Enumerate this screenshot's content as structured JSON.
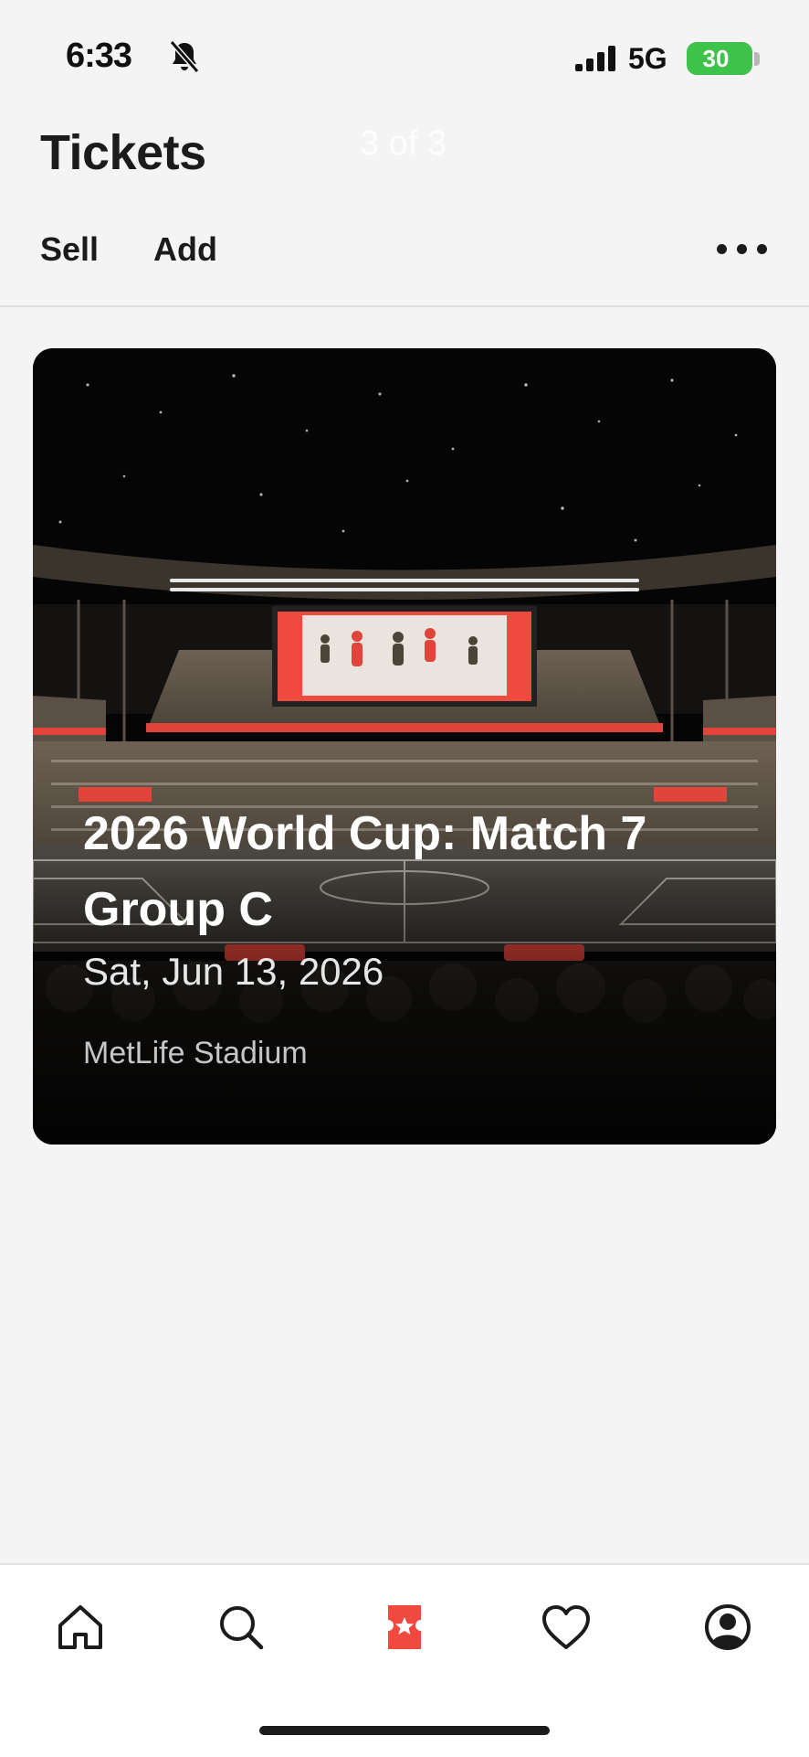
{
  "status_bar": {
    "time": "6:33",
    "network": "5G",
    "battery": "30"
  },
  "header": {
    "title": "Tickets",
    "counter": "3 of 3",
    "actions": {
      "sell": "Sell",
      "add": "Add"
    }
  },
  "event": {
    "title": "2026 World Cup: Match 7 Group C",
    "date": "Sat, Jun 13, 2026",
    "venue": "MetLife Stadium"
  },
  "tab_bar": {
    "tabs": [
      {
        "icon": "home-icon",
        "active": false
      },
      {
        "icon": "search-icon",
        "active": false
      },
      {
        "icon": "ticket-icon",
        "active": true
      },
      {
        "icon": "heart-icon",
        "active": false
      },
      {
        "icon": "profile-icon",
        "active": false
      }
    ]
  },
  "colors": {
    "accent": "#f04a3f",
    "battery": "#3fc24a",
    "background": "#f4f4f5"
  }
}
